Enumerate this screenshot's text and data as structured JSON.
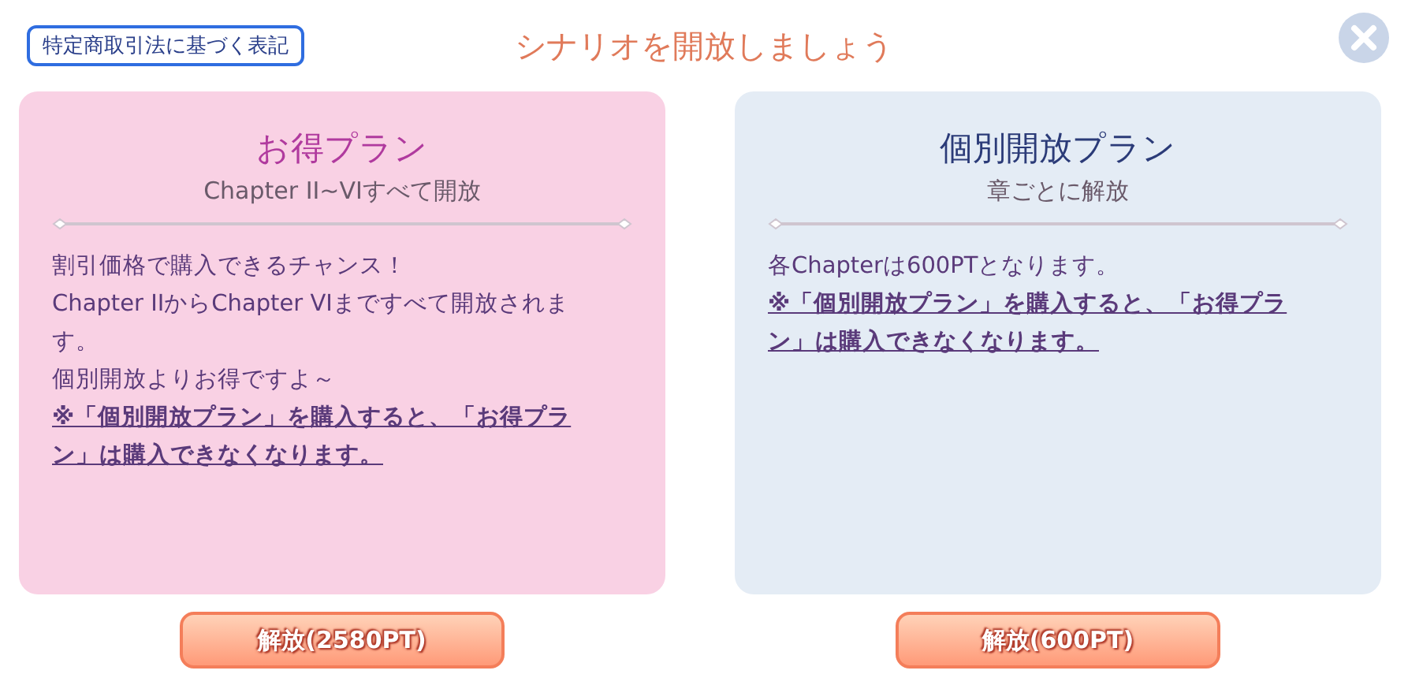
{
  "legal_link": "特定商取引法に基づく表記",
  "title": "シナリオを開放しましょう",
  "plans": [
    {
      "kind": "deal",
      "color": "#f9d1e4",
      "name": "お得プラン",
      "subtitle": "Chapter II~VIすべて開放",
      "lines": [
        {
          "kind": "text",
          "text": "割引価格で購入できるチャンス！"
        },
        {
          "kind": "text",
          "text": "Chapter IIからChapter VIまですべて開放されます。"
        },
        {
          "kind": "text",
          "text": "個別開放よりお得ですよ～"
        },
        {
          "kind": "note",
          "text": "※「個別開放プラン」を購入すると、「お得プラン」は購入できなくなります。"
        }
      ],
      "button": "解放(2580PT)"
    },
    {
      "kind": "single",
      "color": "#e4ecf5",
      "name": "個別開放プラン",
      "subtitle": "章ごとに解放",
      "lines": [
        {
          "kind": "text",
          "text": "各Chapterは600PTとなります。"
        },
        {
          "kind": "note",
          "text": "※「個別開放プラン」を購入すると、「お得プラン」は購入できなくなります。"
        }
      ],
      "button": "解放(600PT)"
    }
  ]
}
